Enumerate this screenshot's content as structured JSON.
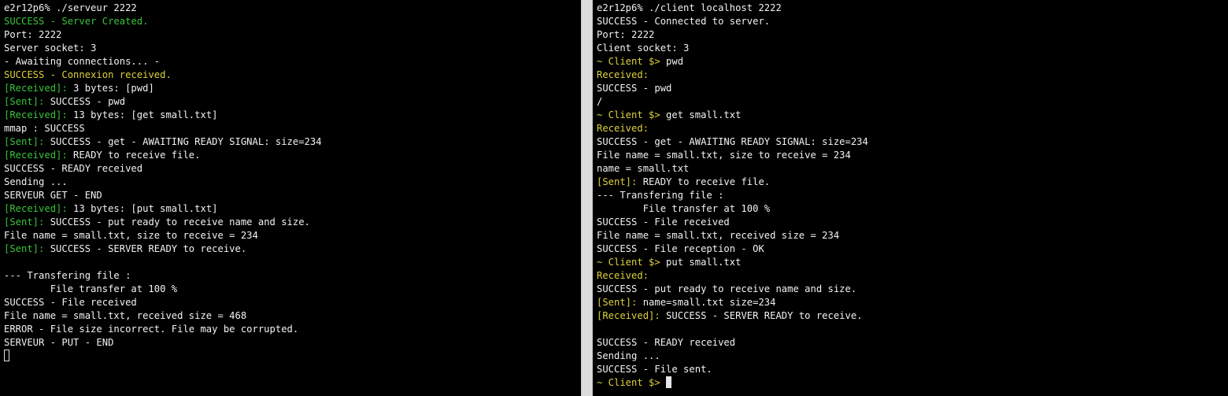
{
  "colors": {
    "background": "#000000",
    "text": "#f2f2f2",
    "green": "#39c33b",
    "yellow": "#dcd03a",
    "separator": "#dcdcdc"
  },
  "terminals": [
    {
      "name": "server",
      "cursor_style": "hollow",
      "lines": [
        [
          {
            "t": "e2r12p6% ./serveur 2222",
            "c": "default"
          }
        ],
        [
          {
            "t": "SUCCESS - Server Created.",
            "c": "green"
          }
        ],
        [
          {
            "t": "Port: 2222",
            "c": "default"
          }
        ],
        [
          {
            "t": "Server socket: 3",
            "c": "default"
          }
        ],
        [
          {
            "t": "- Awaiting connections... -",
            "c": "default"
          }
        ],
        [
          {
            "t": "SUCCESS - Connexion received.",
            "c": "yellow"
          }
        ],
        [
          {
            "t": "[Received]:",
            "c": "green"
          },
          {
            "t": " 3 bytes: [pwd]",
            "c": "default"
          }
        ],
        [
          {
            "t": "[Sent]:",
            "c": "green"
          },
          {
            "t": " SUCCESS - pwd",
            "c": "default"
          }
        ],
        [
          {
            "t": "[Received]:",
            "c": "green"
          },
          {
            "t": " 13 bytes: [get small.txt]",
            "c": "default"
          }
        ],
        [
          {
            "t": "mmap : SUCCESS",
            "c": "default"
          }
        ],
        [
          {
            "t": "[Sent]:",
            "c": "green"
          },
          {
            "t": " SUCCESS - get - AWAITING READY SIGNAL: size=234",
            "c": "default"
          }
        ],
        [
          {
            "t": "[Received]:",
            "c": "green"
          },
          {
            "t": " READY to receive file.",
            "c": "default"
          }
        ],
        [
          {
            "t": "SUCCESS - READY received",
            "c": "default"
          }
        ],
        [
          {
            "t": "Sending ...",
            "c": "default"
          }
        ],
        [
          {
            "t": "SERVEUR GET - END",
            "c": "default"
          }
        ],
        [
          {
            "t": "[Received]:",
            "c": "green"
          },
          {
            "t": " 13 bytes: [put small.txt]",
            "c": "default"
          }
        ],
        [
          {
            "t": "[Sent]:",
            "c": "green"
          },
          {
            "t": " SUCCESS - put ready to receive name and size.",
            "c": "default"
          }
        ],
        [
          {
            "t": "File name = small.txt, size to receive = 234",
            "c": "default"
          }
        ],
        [
          {
            "t": "[Sent]:",
            "c": "green"
          },
          {
            "t": " SUCCESS - SERVER READY to receive.",
            "c": "default"
          }
        ],
        [],
        [
          {
            "t": "--- Transfering file :",
            "c": "default"
          }
        ],
        [
          {
            "t": "        File transfer at 100 %",
            "c": "default"
          }
        ],
        [
          {
            "t": "SUCCESS - File received",
            "c": "default"
          }
        ],
        [
          {
            "t": "File name = small.txt, received size = 468",
            "c": "default"
          }
        ],
        [
          {
            "t": "ERROR - File size incorrect. File may be corrupted.",
            "c": "default"
          }
        ],
        [
          {
            "t": "SERVEUR - PUT - END",
            "c": "default"
          }
        ],
        [
          {
            "cursor": true
          }
        ]
      ]
    },
    {
      "name": "client",
      "cursor_style": "solid",
      "lines": [
        [
          {
            "t": "e2r12p6% ./client localhost 2222",
            "c": "default"
          }
        ],
        [
          {
            "t": "SUCCESS - Connected to server.",
            "c": "default"
          }
        ],
        [
          {
            "t": "Port: 2222",
            "c": "default"
          }
        ],
        [
          {
            "t": "Client socket: 3",
            "c": "default"
          }
        ],
        [
          {
            "t": "~ Client $>",
            "c": "yellow"
          },
          {
            "t": " pwd",
            "c": "default"
          }
        ],
        [
          {
            "t": "Received:",
            "c": "yellow"
          }
        ],
        [
          {
            "t": "SUCCESS - pwd",
            "c": "default"
          }
        ],
        [
          {
            "t": "/",
            "c": "default"
          }
        ],
        [
          {
            "t": "~ Client $>",
            "c": "yellow"
          },
          {
            "t": " get small.txt",
            "c": "default"
          }
        ],
        [
          {
            "t": "Received:",
            "c": "yellow"
          }
        ],
        [
          {
            "t": "SUCCESS - get - AWAITING READY SIGNAL: size=234",
            "c": "default"
          }
        ],
        [
          {
            "t": "File name = small.txt, size to receive = 234",
            "c": "default"
          }
        ],
        [
          {
            "t": "name = small.txt",
            "c": "default"
          }
        ],
        [
          {
            "t": "[Sent]:",
            "c": "yellow"
          },
          {
            "t": " READY to receive file.",
            "c": "default"
          }
        ],
        [
          {
            "t": "--- Transfering file :",
            "c": "default"
          }
        ],
        [
          {
            "t": "        File transfer at 100 %",
            "c": "default"
          }
        ],
        [
          {
            "t": "SUCCESS - File received",
            "c": "default"
          }
        ],
        [
          {
            "t": "File name = small.txt, received size = 234",
            "c": "default"
          }
        ],
        [
          {
            "t": "SUCCESS - File reception - OK",
            "c": "default"
          }
        ],
        [
          {
            "t": "~ Client $>",
            "c": "yellow"
          },
          {
            "t": " put small.txt",
            "c": "default"
          }
        ],
        [
          {
            "t": "Received:",
            "c": "yellow"
          }
        ],
        [
          {
            "t": "SUCCESS - put ready to receive name and size.",
            "c": "default"
          }
        ],
        [
          {
            "t": "[Sent]:",
            "c": "yellow"
          },
          {
            "t": " name=small.txt size=234",
            "c": "default"
          }
        ],
        [
          {
            "t": "[Received]:",
            "c": "yellow"
          },
          {
            "t": " SUCCESS - SERVER READY to receive.",
            "c": "default"
          }
        ],
        [],
        [
          {
            "t": "SUCCESS - READY received",
            "c": "default"
          }
        ],
        [
          {
            "t": "Sending ...",
            "c": "default"
          }
        ],
        [
          {
            "t": "SUCCESS - File sent.",
            "c": "default"
          }
        ],
        [
          {
            "t": "~ Client $>",
            "c": "yellow"
          },
          {
            "t": " ",
            "c": "default"
          },
          {
            "cursor": true
          }
        ]
      ]
    }
  ]
}
